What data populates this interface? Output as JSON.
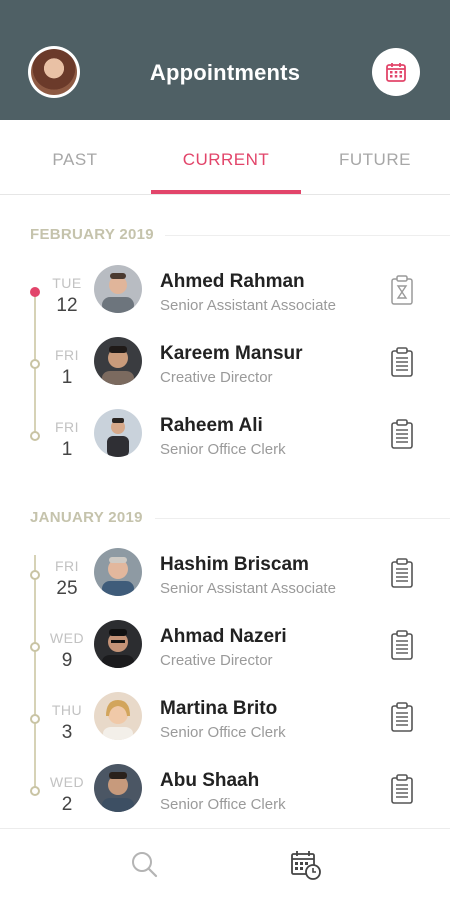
{
  "header": {
    "title": "Appointments",
    "accent_color": "#e2456a",
    "background_color": "#4f6065",
    "profile_avatar_icon": "user-avatar",
    "calendar_icon": "calendar-icon"
  },
  "tabs": [
    {
      "label": "PAST",
      "active": false
    },
    {
      "label": "CURRENT",
      "active": true
    },
    {
      "label": "FUTURE",
      "active": false
    }
  ],
  "sections": [
    {
      "title": "FEBRUARY 2019",
      "appointments": [
        {
          "day": "TUE",
          "date": "12",
          "name": "Ahmed Rahman",
          "role": "Senior Assistant Associate",
          "active": true,
          "icon": "clipboard-hourglass-icon"
        },
        {
          "day": "FRI",
          "date": "1",
          "name": "Kareem Mansur",
          "role": "Creative Director",
          "active": false,
          "icon": "clipboard-list-icon"
        },
        {
          "day": "FRI",
          "date": "1",
          "name": "Raheem Ali",
          "role": "Senior Office Clerk",
          "active": false,
          "icon": "clipboard-list-icon"
        }
      ]
    },
    {
      "title": "JANUARY 2019",
      "appointments": [
        {
          "day": "FRI",
          "date": "25",
          "name": "Hashim Briscam",
          "role": "Senior Assistant Associate",
          "active": false,
          "icon": "clipboard-list-icon"
        },
        {
          "day": "WED",
          "date": "9",
          "name": "Ahmad Nazeri",
          "role": "Creative Director",
          "active": false,
          "icon": "clipboard-list-icon"
        },
        {
          "day": "THU",
          "date": "3",
          "name": "Martina Brito",
          "role": "Senior Office Clerk",
          "active": false,
          "icon": "clipboard-list-icon"
        },
        {
          "day": "WED",
          "date": "2",
          "name": "Abu Shaah",
          "role": "Senior Office Clerk",
          "active": false,
          "icon": "clipboard-list-icon"
        }
      ]
    }
  ],
  "bottom_nav": {
    "items": [
      {
        "icon": "search-icon",
        "active": false
      },
      {
        "icon": "calendar-clock-icon",
        "active": true
      }
    ]
  }
}
